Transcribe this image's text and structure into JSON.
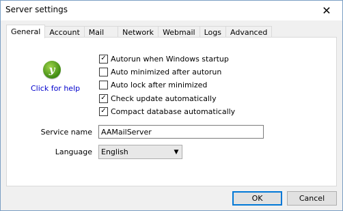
{
  "window": {
    "title": "Server settings",
    "close_glyph": "✕"
  },
  "tabs": [
    {
      "label": "General",
      "active": true
    },
    {
      "label": "Account"
    },
    {
      "label": "Mail"
    },
    {
      "label": "Network"
    },
    {
      "label": "Webmail"
    },
    {
      "label": "Logs"
    },
    {
      "label": "Advanced"
    }
  ],
  "help": {
    "logo_letter": "y",
    "link": "Click for help"
  },
  "checkboxes": [
    {
      "label": "Autorun when Windows startup",
      "checked": true
    },
    {
      "label": "Auto minimized after autorun",
      "checked": false
    },
    {
      "label": "Auto lock after minimized",
      "checked": false
    },
    {
      "label": "Check update automatically",
      "checked": true
    },
    {
      "label": "Compact database automatically",
      "checked": true
    }
  ],
  "service": {
    "label": "Service name",
    "value": "AAMailServer"
  },
  "language": {
    "label": "Language",
    "value": "English"
  },
  "buttons": {
    "ok": "OK",
    "cancel": "Cancel"
  },
  "check_glyph": "✓"
}
